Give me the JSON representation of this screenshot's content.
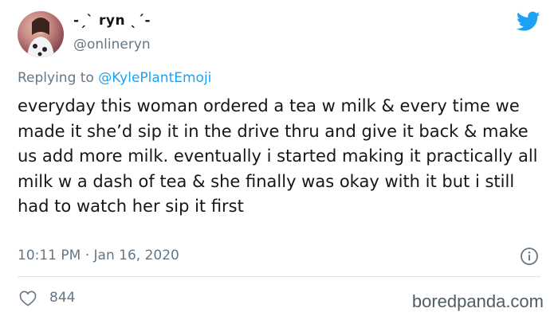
{
  "tweet": {
    "display_name": "-ˏˋ ryn ˎˊ-",
    "handle": "@onlineryn",
    "reply_prefix": "Replying to ",
    "reply_to": "@KylePlantEmoji",
    "text": "everyday this woman ordered a tea w milk & every time we made it she’d sip it in the drive thru and give it back & make us add more milk. eventually i started making it practically all milk w a dash of tea & she finally was okay with it but i still had to watch her sip it first",
    "timestamp": "10:11 PM · Jan 16, 2020",
    "likes": "844"
  },
  "watermark": "boredpanda.com",
  "colors": {
    "twitter_blue": "#1da1f2",
    "secondary_text": "#657786"
  },
  "icons": {
    "brand": "twitter-bird-icon",
    "info": "info-icon",
    "like": "heart-icon"
  }
}
